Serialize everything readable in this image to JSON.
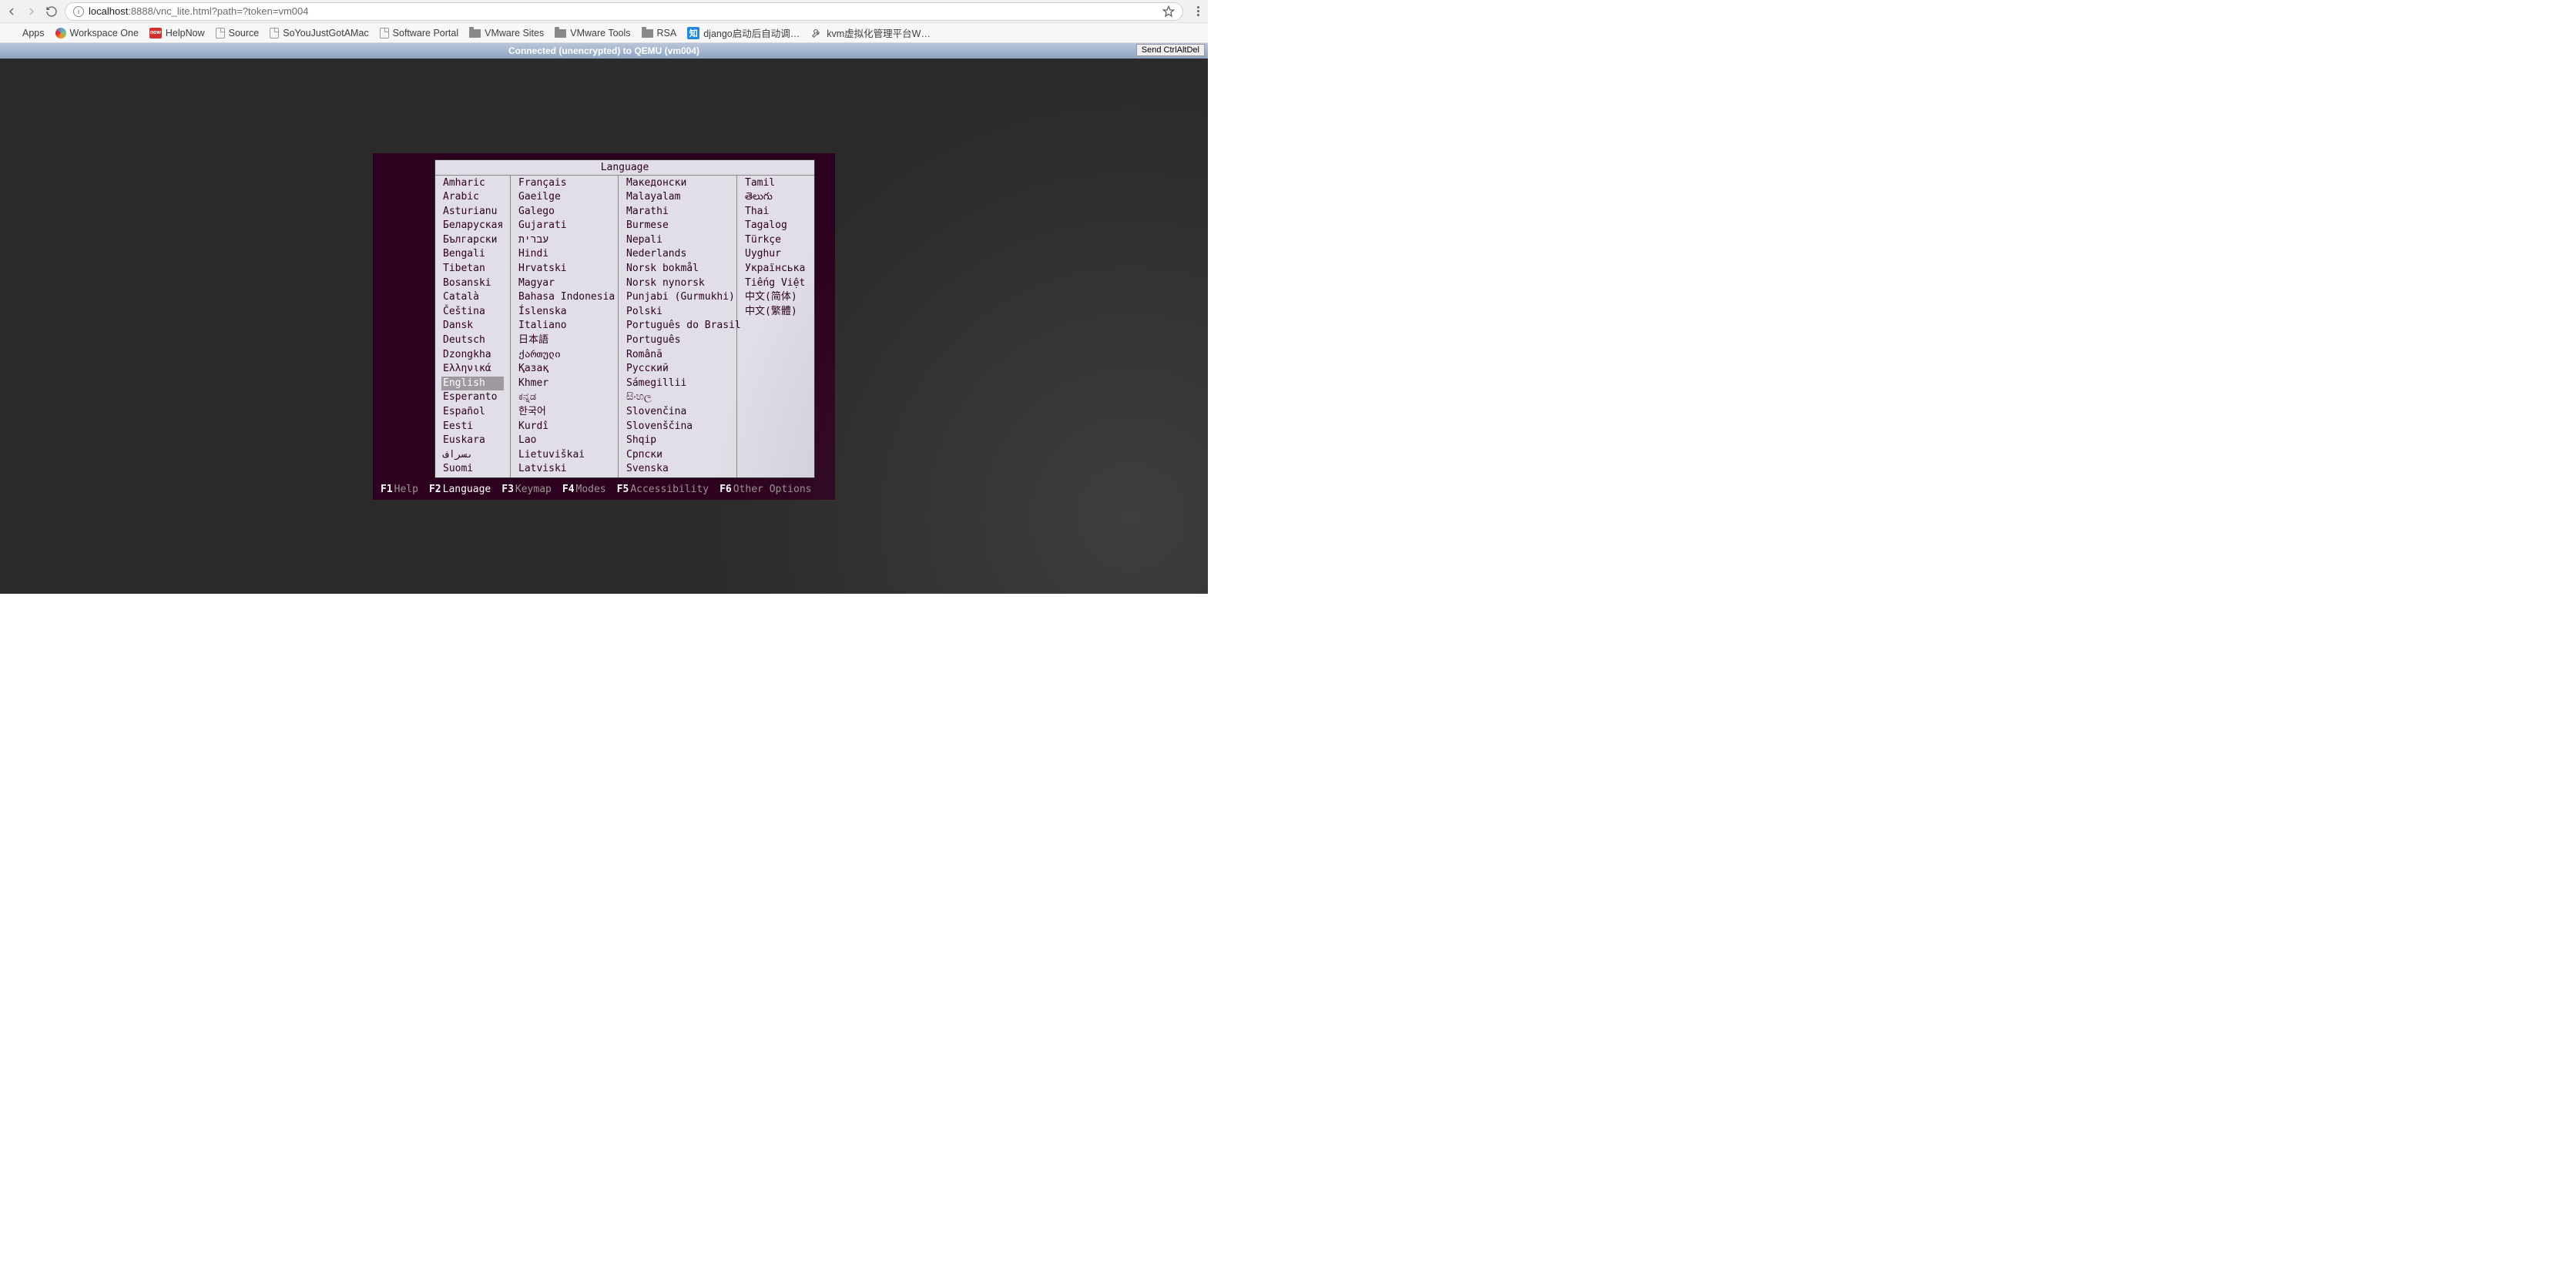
{
  "browser": {
    "url_host": "localhost",
    "url_port_path": ":8888/vnc_lite.html?path=?token=vm004",
    "bookmarks": [
      {
        "label": "Apps",
        "icon": "apps"
      },
      {
        "label": "Workspace One",
        "icon": "ws"
      },
      {
        "label": "HelpNow",
        "icon": "red",
        "badge": "now"
      },
      {
        "label": "Source",
        "icon": "page"
      },
      {
        "label": "SoYouJustGotAMac",
        "icon": "page"
      },
      {
        "label": "Software Portal",
        "icon": "page"
      },
      {
        "label": "VMware Sites",
        "icon": "folder"
      },
      {
        "label": "VMware Tools",
        "icon": "folder"
      },
      {
        "label": "RSA",
        "icon": "folder"
      },
      {
        "label": "django启动后自动调…",
        "icon": "blue",
        "badge": "知"
      },
      {
        "label": "kvm虚拟化管理平台W…",
        "icon": "wrench"
      }
    ]
  },
  "novnc": {
    "status": "Connected (unencrypted) to QEMU (vm004)",
    "send_btn": "Send CtrlAltDel"
  },
  "installer": {
    "title": "Language",
    "selected": "English",
    "columns": [
      [
        "Amharic",
        "Arabic",
        "Asturianu",
        "Беларуская",
        "Български",
        "Bengali",
        "Tibetan",
        "Bosanski",
        "Català",
        "Čeština",
        "Dansk",
        "Deutsch",
        "Dzongkha",
        "Ελληνικά",
        "English",
        "Esperanto",
        "Español",
        "Eesti",
        "Euskara",
        "ىسراف",
        "Suomi"
      ],
      [
        "Français",
        "Gaeilge",
        "Galego",
        "Gujarati",
        "עברית",
        "Hindi",
        "Hrvatski",
        "Magyar",
        "Bahasa Indonesia",
        "Íslenska",
        "Italiano",
        "日本語",
        "ქართული",
        "Қазақ",
        "Khmer",
        "ಕನ್ನಡ",
        "한국어",
        "Kurdî",
        "Lao",
        "Lietuviškai",
        "Latviski"
      ],
      [
        "Македонски",
        "Malayalam",
        "Marathi",
        "Burmese",
        "Nepali",
        "Nederlands",
        "Norsk bokmål",
        "Norsk nynorsk",
        "Punjabi (Gurmukhi)",
        "Polski",
        "Português do Brasil",
        "Português",
        "Română",
        "Русский",
        "Sámegillii",
        "සිංහල",
        "Slovenčina",
        "Slovenščina",
        "Shqip",
        "Српски",
        "Svenska"
      ],
      [
        "Tamil",
        "తెలుగు",
        "Thai",
        "Tagalog",
        "Türkçe",
        "Uyghur",
        "Українська",
        "Tiếng Việt",
        "中文(简体)",
        "中文(繁體)"
      ]
    ],
    "fkeys": [
      {
        "key": "F1",
        "label": "Help",
        "active": false
      },
      {
        "key": "F2",
        "label": "Language",
        "active": true
      },
      {
        "key": "F3",
        "label": "Keymap",
        "active": false
      },
      {
        "key": "F4",
        "label": "Modes",
        "active": false
      },
      {
        "key": "F5",
        "label": "Accessibility",
        "active": false
      },
      {
        "key": "F6",
        "label": "Other Options",
        "active": false
      }
    ]
  }
}
